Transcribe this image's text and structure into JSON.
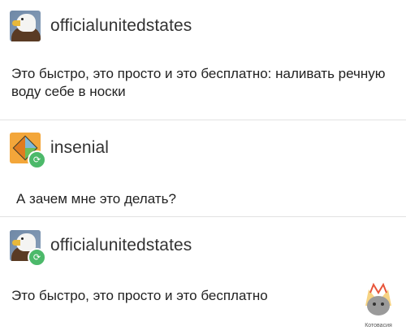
{
  "posts": [
    {
      "username": "officialunitedstates",
      "avatar_icon": "eagle-avatar",
      "reblog": false,
      "text": "Это быстро, это просто и это бесплатно: наливать речную воду себе в носки"
    },
    {
      "username": "insenial",
      "avatar_icon": "orange-diamond-avatar",
      "reblog": true,
      "text": "А зачем мне это делать?"
    },
    {
      "username": "officialunitedstates",
      "avatar_icon": "eagle-avatar",
      "reblog": true,
      "text": "Это быстро, это просто и это бесплатно"
    }
  ],
  "reblog_icon": "reblog-icon",
  "watermark": {
    "text": "Котовасия"
  },
  "colors": {
    "reblog": "#4cb96a",
    "orange_avatar": "#f3a63a",
    "divider": "#e2e2e2"
  }
}
